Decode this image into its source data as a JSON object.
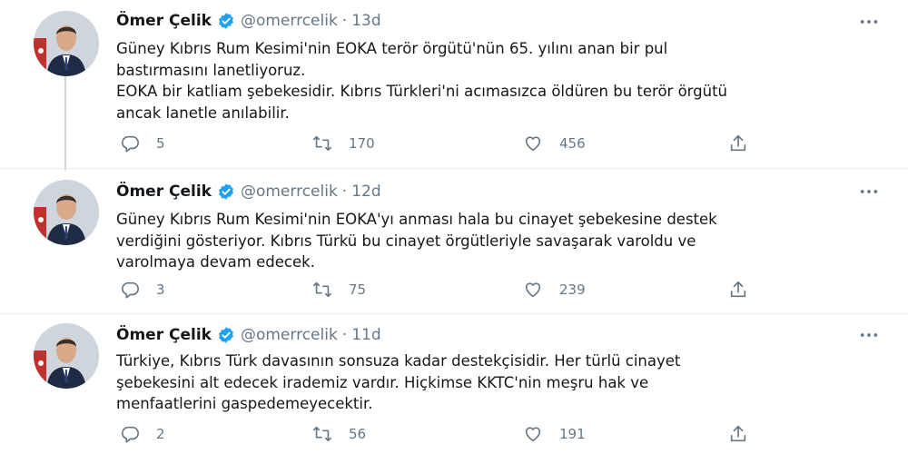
{
  "tweets": [
    {
      "name": "Ömer Çelik",
      "handle": "@omerrcelik",
      "separator": "·",
      "time": "13d",
      "lines": [
        "Güney Kıbrıs Rum Kesimi'nin EOKA terör örgütü'nün 65. yılını anan bir pul",
        "bastırmasını lanetliyoruz.",
        "EOKA bir katliam şebekesidir. Kıbrıs Türkleri'ni acımasızca öldüren bu terör örgütü",
        "ancak lanetle anılabilir."
      ],
      "replies": "5",
      "retweets": "170",
      "likes": "456"
    },
    {
      "name": "Ömer Çelik",
      "handle": "@omerrcelik",
      "separator": "·",
      "time": "12d",
      "lines": [
        "Güney Kıbrıs Rum Kesimi'nin EOKA'yı anması hala bu cinayet şebekesine destek",
        "verdiğini gösteriyor. Kıbrıs Türkü bu cinayet örgütleriyle savaşarak varoldu ve",
        "varolmaya devam edecek."
      ],
      "replies": "3",
      "retweets": "75",
      "likes": "239"
    },
    {
      "name": "Ömer Çelik",
      "handle": "@omerrcelik",
      "separator": "·",
      "time": "11d",
      "lines": [
        "Türkiye, Kıbrıs Türk davasının sonsuza kadar destekçisidir. Her türlü cinayet",
        "şebekesini alt edecek irademiz vardır. Hiçkimse KKTC'nin meşru hak ve",
        "menfaatlerini gaspedemeyecektir."
      ],
      "replies": "2",
      "retweets": "56",
      "likes": "191"
    }
  ],
  "icons": {
    "more": "more-icon",
    "reply": "reply-icon",
    "retweet": "retweet-icon",
    "like": "like-icon",
    "share": "share-icon",
    "verified": "verified-badge-icon"
  },
  "colors": {
    "verified": "#1da1f2",
    "secondary_text": "#657786",
    "divider": "#e6ecf0",
    "thread_line": "#ccd6dd"
  }
}
